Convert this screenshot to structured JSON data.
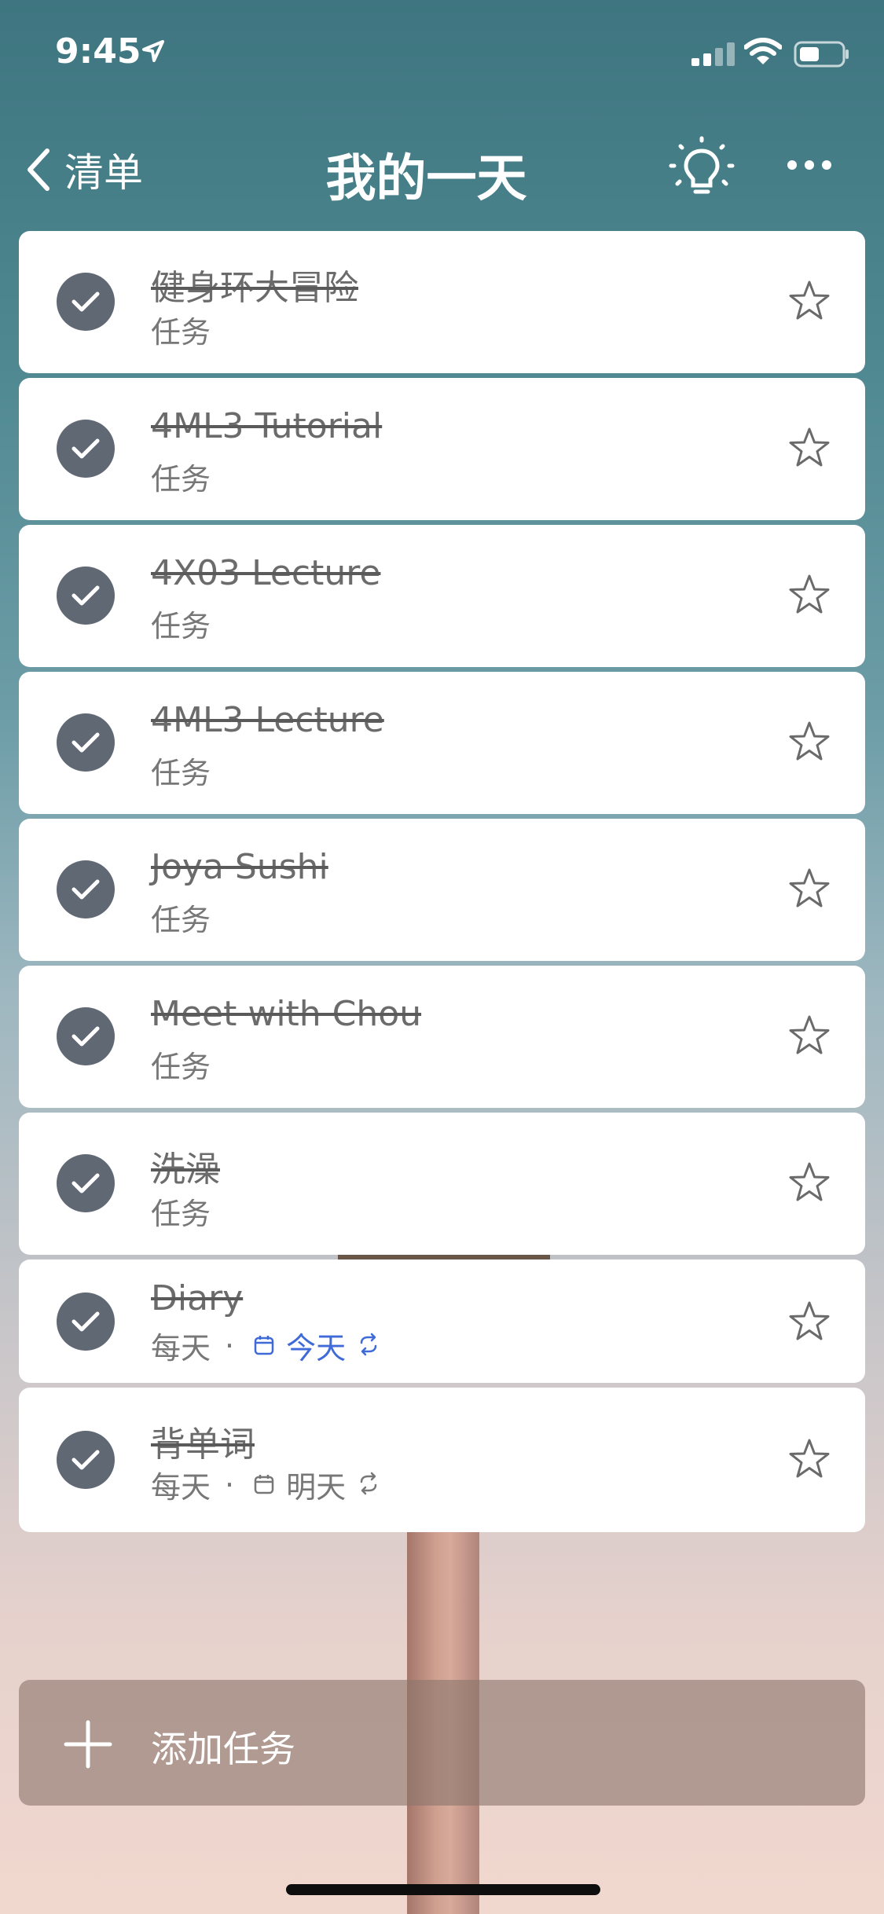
{
  "status_bar": {
    "time": "9:45",
    "location_icon": "location-arrow-icon",
    "signal_icon": "cellular-signal-icon",
    "wifi_icon": "wifi-icon",
    "battery_icon": "battery-icon"
  },
  "nav": {
    "back_label": "清单",
    "title": "我的一天",
    "suggestions_icon": "lightbulb-icon",
    "more_icon": "ellipsis-icon"
  },
  "tasks": [
    {
      "title": "健身环大冒险",
      "subtitle": "任务",
      "completed": true,
      "starred": false
    },
    {
      "title": "4ML3 Tutorial",
      "subtitle": "任务",
      "completed": true,
      "starred": false
    },
    {
      "title": "4X03 Lecture",
      "subtitle": "任务",
      "completed": true,
      "starred": false
    },
    {
      "title": "4ML3 Lecture",
      "subtitle": "任务",
      "completed": true,
      "starred": false
    },
    {
      "title": "Joya Sushi",
      "subtitle": "任务",
      "completed": true,
      "starred": false
    },
    {
      "title": "Meet with Chou",
      "subtitle": "任务",
      "completed": true,
      "starred": false
    },
    {
      "title": "洗澡",
      "subtitle": "任务",
      "completed": true,
      "starred": false
    },
    {
      "title": "Diary",
      "subtitle": "每天",
      "separator": "·",
      "due": "今天",
      "repeat": true,
      "completed": true,
      "starred": false
    },
    {
      "title": "背单词",
      "subtitle": "每天",
      "separator": "·",
      "due": "明天",
      "repeat": true,
      "completed": true,
      "starred": false
    }
  ],
  "add_task": {
    "label": "添加任务",
    "icon": "plus-icon"
  },
  "colors": {
    "accent_blue": "#3f6ad8",
    "check_fill": "#606874",
    "completed_text": "#6b6b6b"
  }
}
